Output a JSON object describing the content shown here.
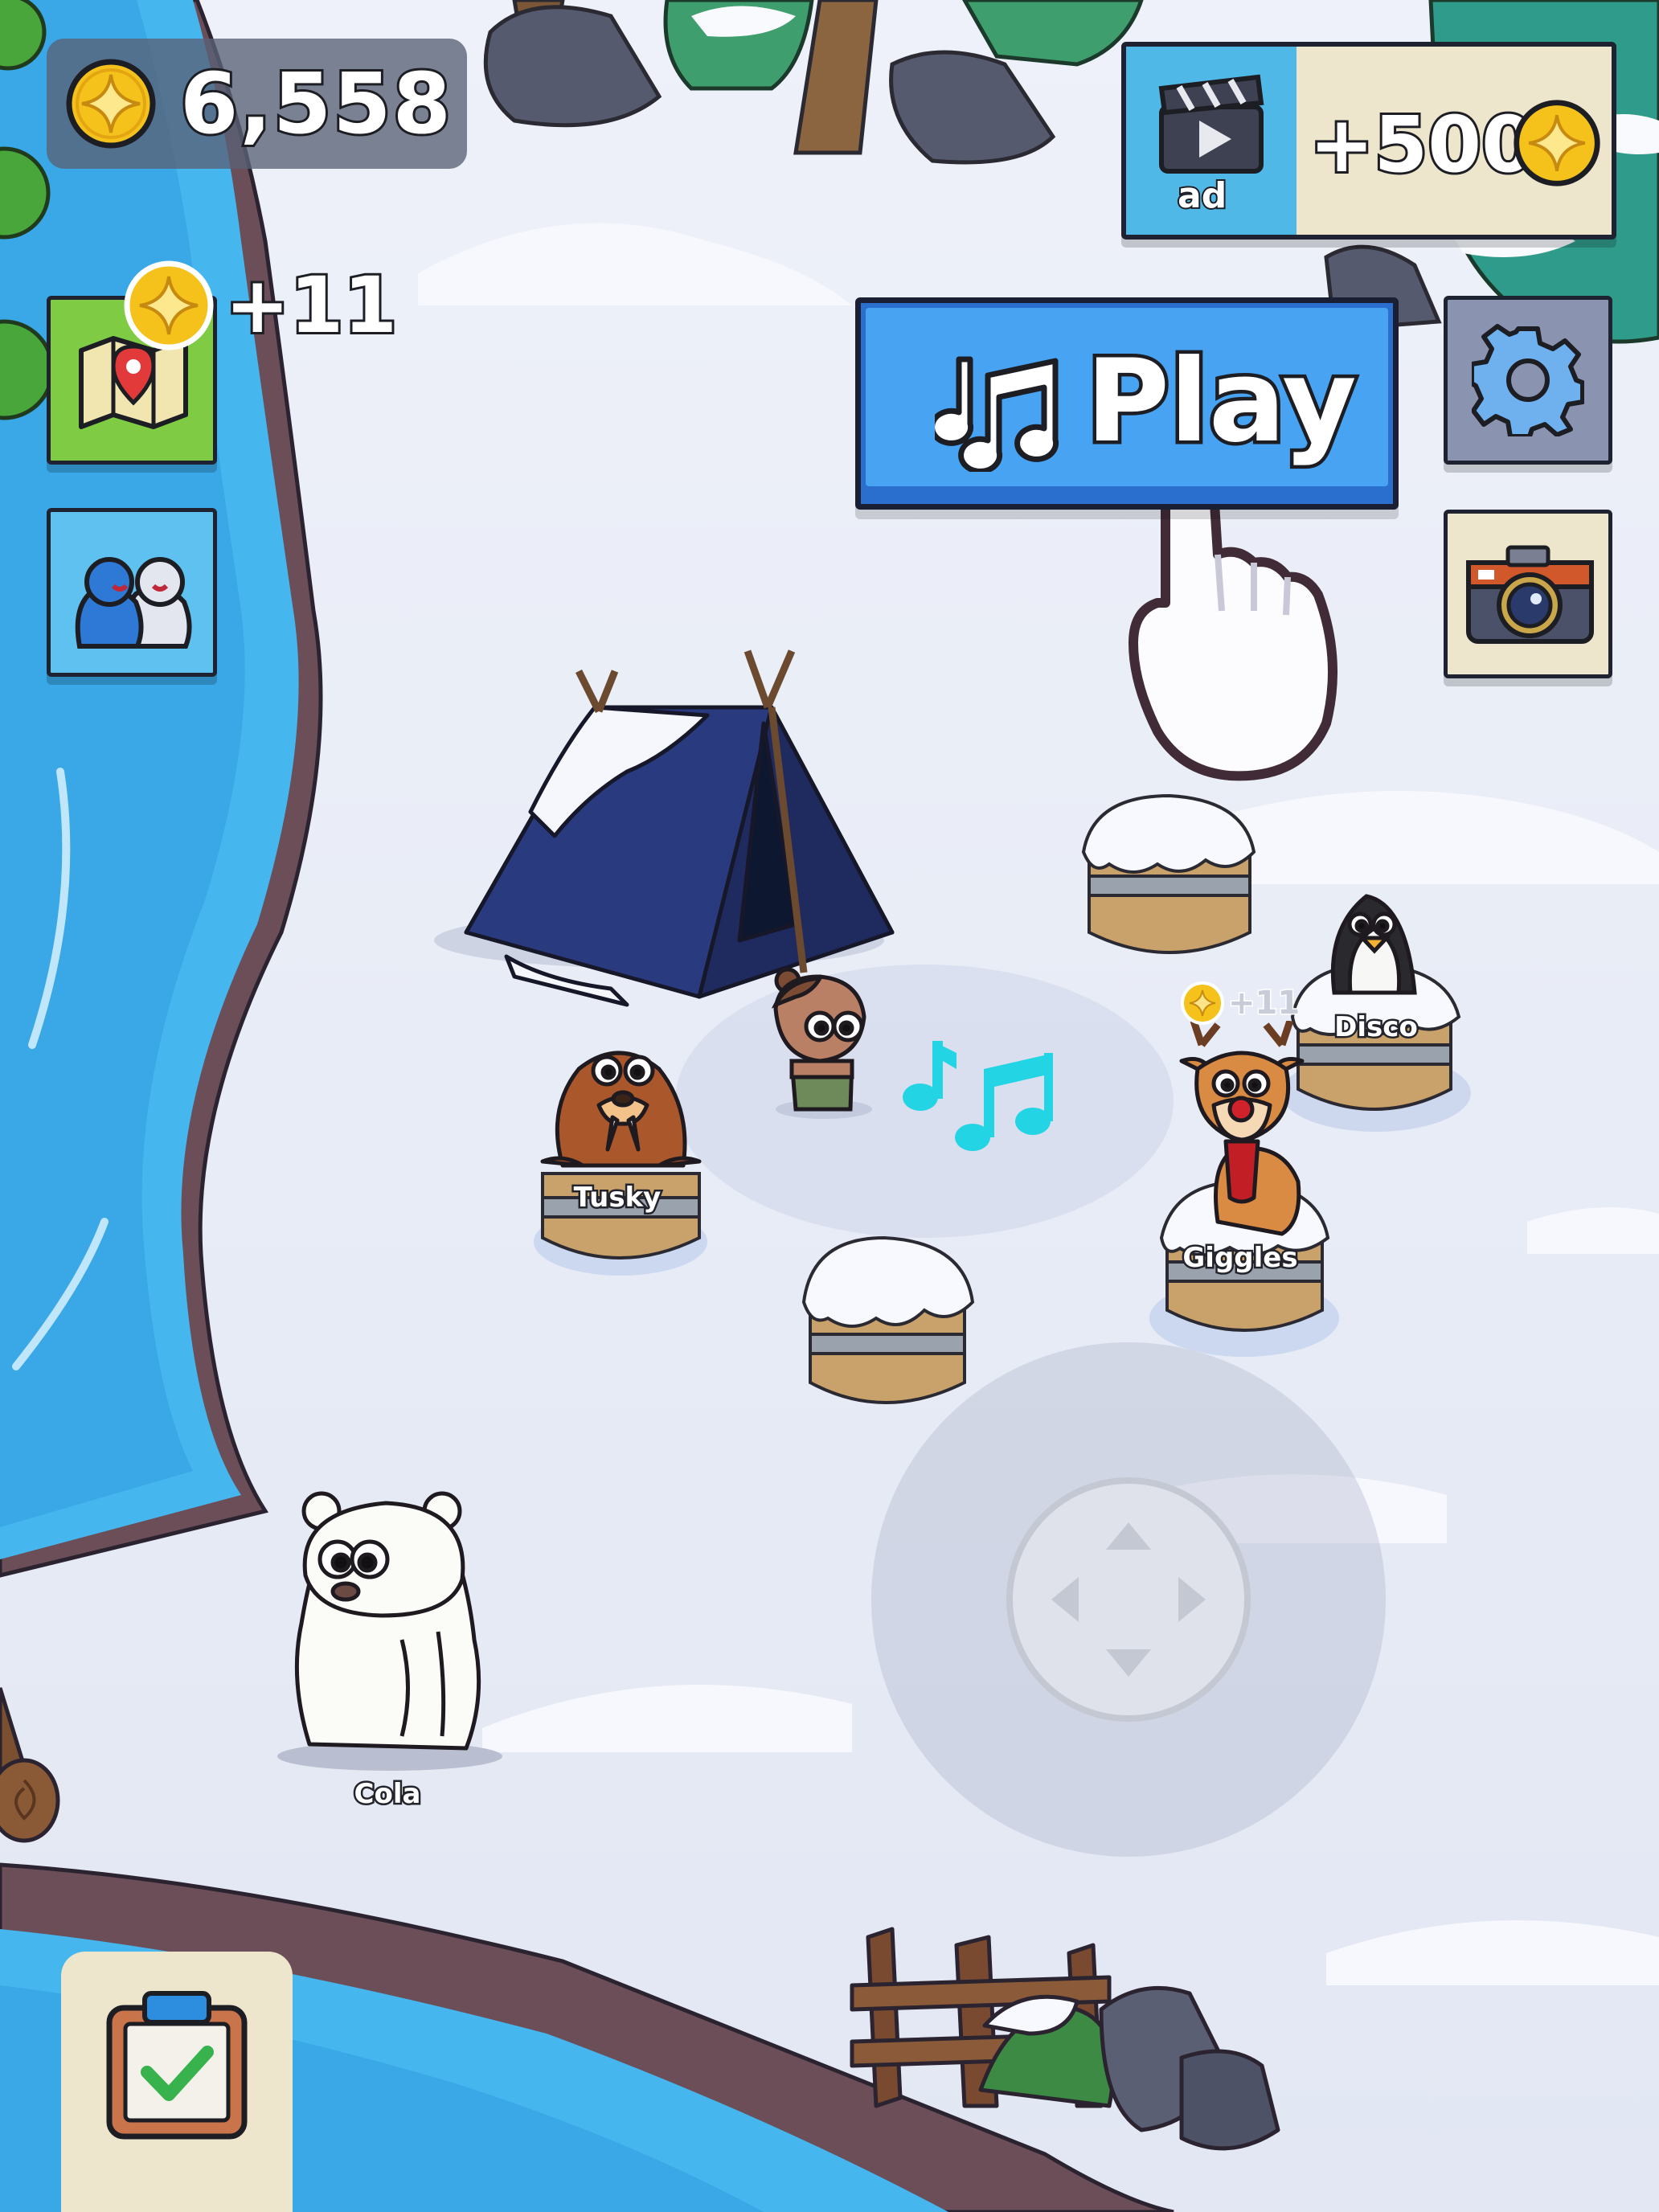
{
  "hud": {
    "coins": "6,558",
    "coin_bonus": "+11",
    "ad_reward": "+500",
    "ad_label": "ad",
    "play_label": "Play"
  },
  "characters": [
    {
      "name": "Tusky"
    },
    {
      "name": "Disco"
    },
    {
      "name": "Giggles"
    },
    {
      "name": "Cola"
    }
  ],
  "giggles_bonus": "+11",
  "icons": {
    "coin": "coin-icon",
    "clapperboard": "clapperboard-icon",
    "music": "music-notes-icon",
    "settings": "gear-icon",
    "map": "map-icon",
    "friends": "friends-icon",
    "camera": "camera-icon",
    "tasks": "clipboard-icon",
    "hand": "tap-hand-icon",
    "joystick": "joystick-icon"
  },
  "colors": {
    "coin": "#f5c21b",
    "play_button": "#3d95f0",
    "snow": "#e6ebf6",
    "water": "#44b4ee",
    "music_notes": "#22d4e4"
  }
}
